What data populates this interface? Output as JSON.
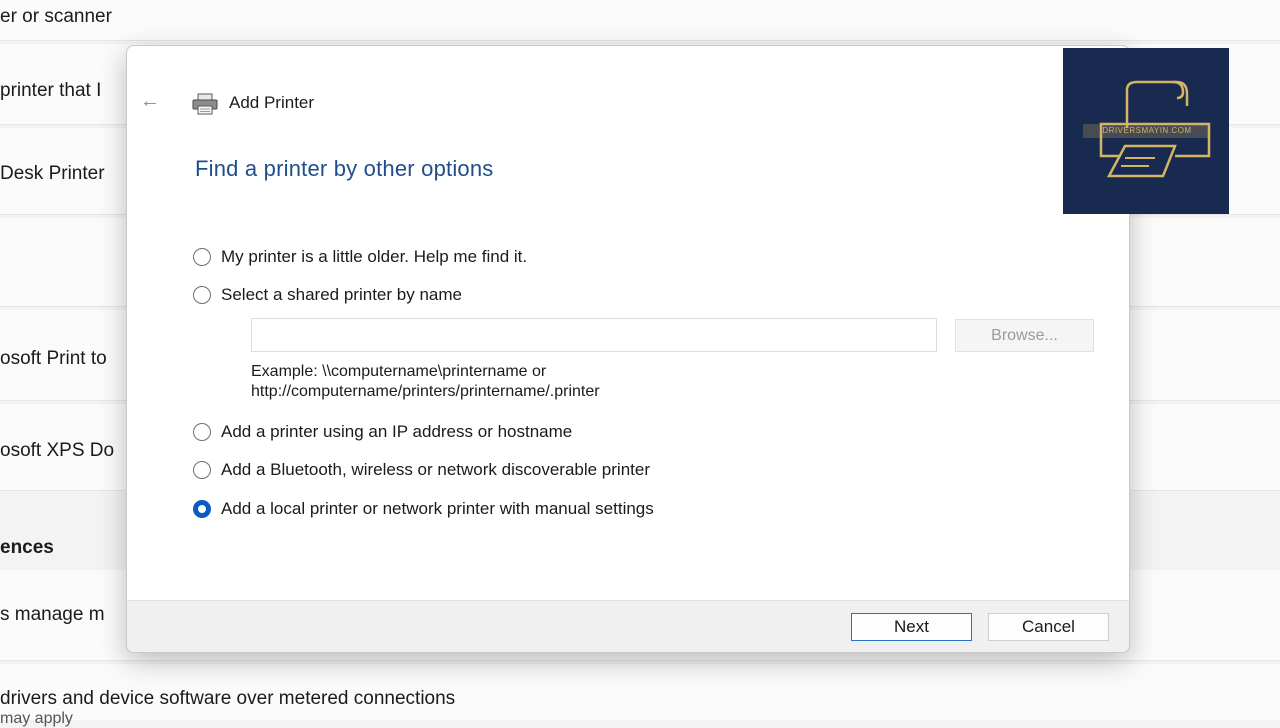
{
  "background": {
    "rows": [
      "er or scanner",
      "printer that I",
      "Desk Printer",
      "osoft Print to",
      "osoft XPS Do",
      "ences",
      "s manage m",
      "drivers and device software over metered connections",
      "may apply"
    ]
  },
  "dialog": {
    "title": "Add Printer",
    "heading": "Find a printer by other options",
    "options": [
      {
        "label": "My printer is a little older. Help me find it.",
        "checked": false
      },
      {
        "label": "Select a shared printer by name",
        "checked": false
      },
      {
        "label": "Add a printer using an IP address or hostname",
        "checked": false
      },
      {
        "label": "Add a Bluetooth, wireless or network discoverable printer",
        "checked": false
      },
      {
        "label": "Add a local printer or network printer with manual settings",
        "checked": true
      }
    ],
    "shared_name_input": {
      "value": "",
      "placeholder": ""
    },
    "browse_label": "Browse...",
    "example_line1": "Example: \\\\computername\\printername or",
    "example_line2": "http://computername/printers/printername/.printer",
    "next_label": "Next",
    "cancel_label": "Cancel"
  },
  "watermark": {
    "text": "DRIVERSMAYIN.COM"
  },
  "colors": {
    "accent": "#0a5bc4",
    "heading": "#1f4e8c",
    "logo_bg": "#182a4f",
    "logo_gold": "#d5b463"
  }
}
